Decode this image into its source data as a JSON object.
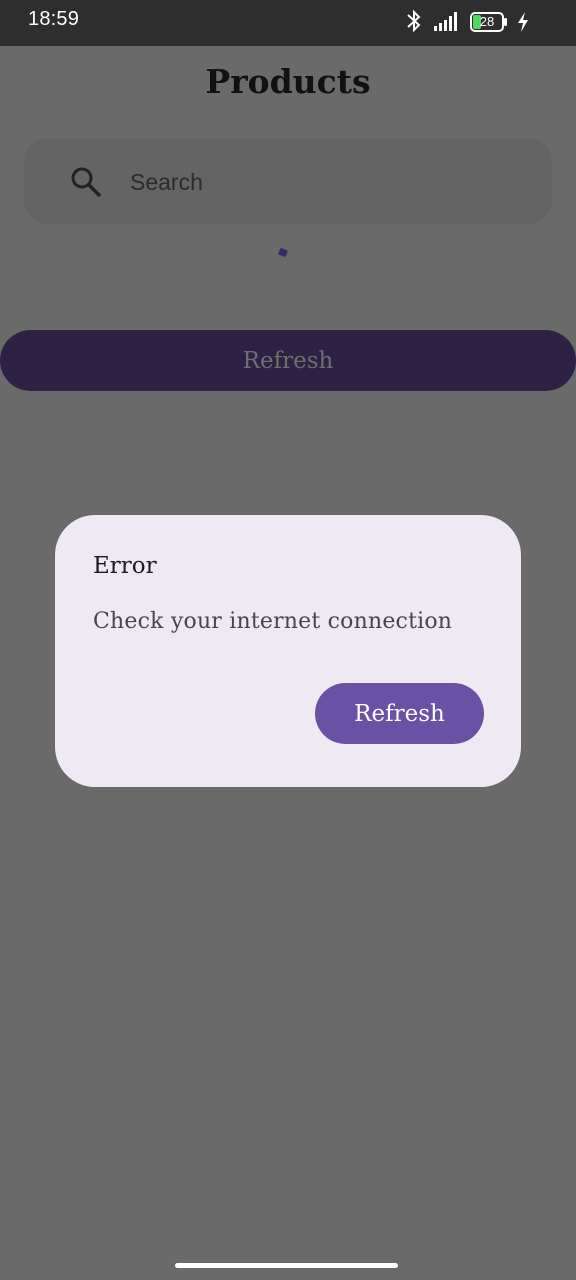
{
  "status_bar": {
    "time": "18:59",
    "battery_level": "28",
    "icons": [
      "bluetooth-icon",
      "signal-icon",
      "battery-icon",
      "charging-icon"
    ]
  },
  "header": {
    "title": "Products"
  },
  "search": {
    "placeholder": "Search",
    "value": "",
    "icon": "search-icon"
  },
  "main": {
    "refresh_label": "Refresh"
  },
  "dialog": {
    "title": "Error",
    "message": "Check your internet connection",
    "button_label": "Refresh"
  },
  "colors": {
    "scrim": "#6a6a6a",
    "dialog_background": "#efe9f4",
    "accent": "#6a51a6",
    "refresh_bar": "#2d2244"
  }
}
